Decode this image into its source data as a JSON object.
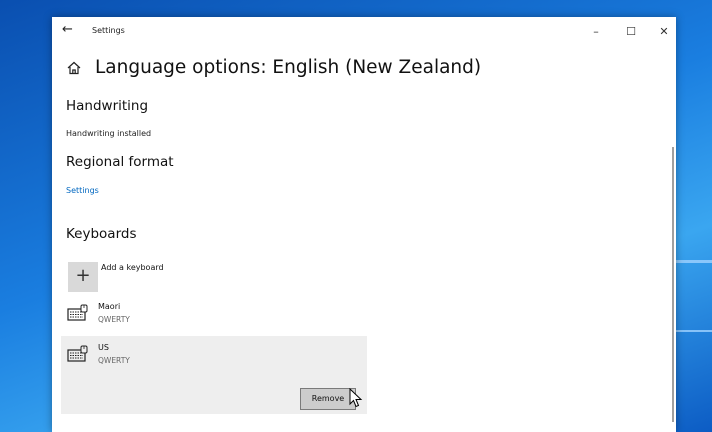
{
  "window": {
    "title": "Settings",
    "back_icon": "back-arrow-icon",
    "controls": [
      "minimize-icon",
      "maximize-icon",
      "close-icon"
    ]
  },
  "page": {
    "title": "Language options: English (New Zealand)",
    "home_icon": "home-icon"
  },
  "handwriting": {
    "heading": "Handwriting",
    "status": "Handwriting installed"
  },
  "regional_format": {
    "heading": "Regional format",
    "settings_link": "Settings"
  },
  "keyboards": {
    "heading": "Keyboards",
    "add_label": "Add a keyboard",
    "items": [
      {
        "name": "Maori",
        "layout": "QWERTY",
        "icon": "keyboard-icon"
      },
      {
        "name": "US",
        "layout": "QWERTY",
        "icon": "keyboard-icon",
        "selected": true
      }
    ],
    "remove_label": "Remove"
  },
  "colors": {
    "accent": "#0067c0",
    "selected_bg": "#eeeeee",
    "button_bg": "#cccccc"
  }
}
